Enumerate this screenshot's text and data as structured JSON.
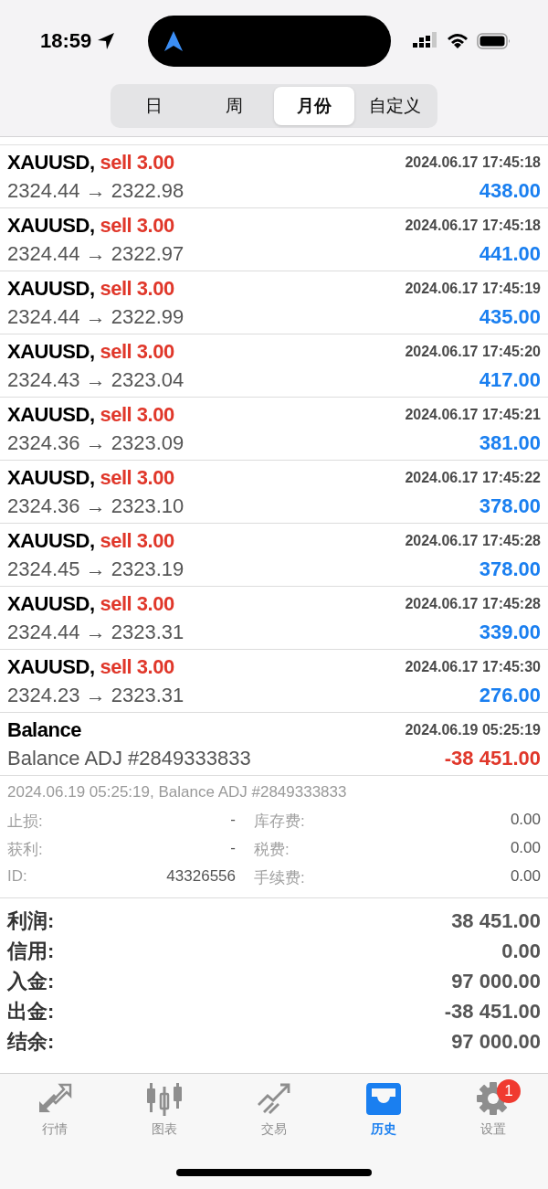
{
  "status_bar": {
    "time": "18:59"
  },
  "period_tabs": [
    {
      "label": "日",
      "selected": false
    },
    {
      "label": "周",
      "selected": false
    },
    {
      "label": "月份",
      "selected": true
    },
    {
      "label": "自定义",
      "selected": false
    }
  ],
  "deals": [
    {
      "kind": "trade",
      "symbol": "XAUUSD,",
      "side": "sell 3.00",
      "time": "2024.06.17 17:45:18",
      "prices": "2324.44 → 2322.98",
      "profit": "438.00",
      "loss": false
    },
    {
      "kind": "trade",
      "symbol": "XAUUSD,",
      "side": "sell 3.00",
      "time": "2024.06.17 17:45:18",
      "prices": "2324.44 → 2322.97",
      "profit": "441.00",
      "loss": false
    },
    {
      "kind": "trade",
      "symbol": "XAUUSD,",
      "side": "sell 3.00",
      "time": "2024.06.17 17:45:19",
      "prices": "2324.44 → 2322.99",
      "profit": "435.00",
      "loss": false
    },
    {
      "kind": "trade",
      "symbol": "XAUUSD,",
      "side": "sell 3.00",
      "time": "2024.06.17 17:45:20",
      "prices": "2324.43 → 2323.04",
      "profit": "417.00",
      "loss": false
    },
    {
      "kind": "trade",
      "symbol": "XAUUSD,",
      "side": "sell 3.00",
      "time": "2024.06.17 17:45:21",
      "prices": "2324.36 → 2323.09",
      "profit": "381.00",
      "loss": false
    },
    {
      "kind": "trade",
      "symbol": "XAUUSD,",
      "side": "sell 3.00",
      "time": "2024.06.17 17:45:22",
      "prices": "2324.36 → 2323.10",
      "profit": "378.00",
      "loss": false
    },
    {
      "kind": "trade",
      "symbol": "XAUUSD,",
      "side": "sell 3.00",
      "time": "2024.06.17 17:45:28",
      "prices": "2324.45 → 2323.19",
      "profit": "378.00",
      "loss": false
    },
    {
      "kind": "trade",
      "symbol": "XAUUSD,",
      "side": "sell 3.00",
      "time": "2024.06.17 17:45:28",
      "prices": "2324.44 → 2323.31",
      "profit": "339.00",
      "loss": false
    },
    {
      "kind": "trade",
      "symbol": "XAUUSD,",
      "side": "sell 3.00",
      "time": "2024.06.17 17:45:30",
      "prices": "2324.23 → 2323.31",
      "profit": "276.00",
      "loss": false
    },
    {
      "kind": "balance",
      "symbol": "Balance",
      "time": "2024.06.19 05:25:19",
      "prices": "Balance ADJ #2849333833",
      "profit": "-38 451.00",
      "loss": true
    }
  ],
  "deal_details": {
    "summary": "2024.06.19 05:25:19, Balance ADJ #2849333833",
    "fields": [
      {
        "label": "止损:",
        "value": "-"
      },
      {
        "label": "库存费:",
        "value": "0.00"
      },
      {
        "label": "获利:",
        "value": "-"
      },
      {
        "label": "税费:",
        "value": "0.00"
      },
      {
        "label": "ID:",
        "value": "43326556"
      },
      {
        "label": "手续费:",
        "value": "0.00"
      }
    ]
  },
  "totals": [
    {
      "label": "利润:",
      "value": "38 451.00"
    },
    {
      "label": "信用:",
      "value": "0.00"
    },
    {
      "label": "入金:",
      "value": "97 000.00"
    },
    {
      "label": "出金:",
      "value": "-38 451.00"
    },
    {
      "label": "结余:",
      "value": "97 000.00"
    }
  ],
  "tab_bar": [
    {
      "label": "行情",
      "selected": false
    },
    {
      "label": "图表",
      "selected": false
    },
    {
      "label": "交易",
      "selected": false
    },
    {
      "label": "历史",
      "selected": true
    },
    {
      "label": "设置",
      "selected": false,
      "badge": "1"
    }
  ]
}
